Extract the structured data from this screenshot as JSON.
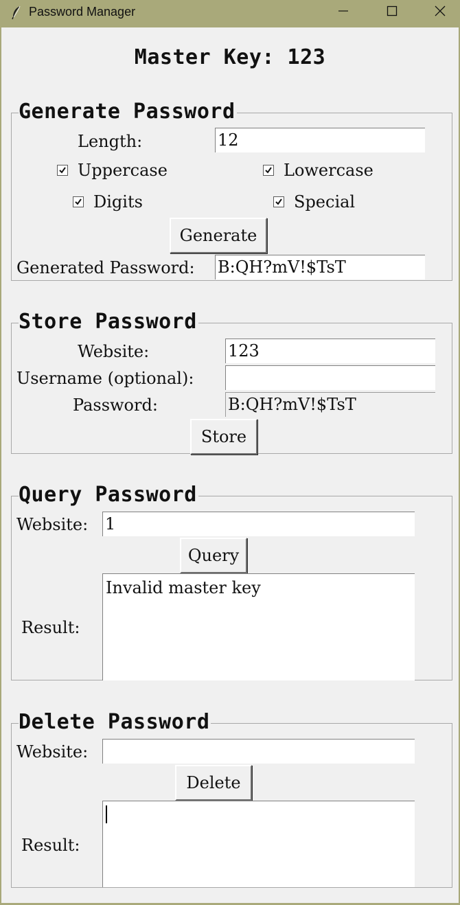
{
  "window": {
    "title": "Password Manager"
  },
  "master_key": "Master Key: 123",
  "generate": {
    "legend": "Generate Password",
    "length_label": "Length:",
    "length_value": "12",
    "uppercase_label": "Uppercase",
    "uppercase_checked": true,
    "lowercase_label": "Lowercase",
    "lowercase_checked": true,
    "digits_label": "Digits",
    "digits_checked": true,
    "special_label": "Special",
    "special_checked": true,
    "button": "Generate",
    "result_label": "Generated Password:",
    "result_value": "B:QH?mV!$TsT"
  },
  "store": {
    "legend": "Store Password",
    "website_label": "Website:",
    "website_value": "123",
    "username_label": "Username (optional):",
    "username_value": "",
    "password_label": "Password:",
    "password_value": "B:QH?mV!$TsT",
    "button": "Store"
  },
  "query": {
    "legend": "Query Password",
    "website_label": "Website:",
    "website_value": "1",
    "button": "Query",
    "result_label": "Result:",
    "result_text": "Invalid master key"
  },
  "delete": {
    "legend": "Delete Password",
    "website_label": "Website:",
    "website_value": "",
    "button": "Delete",
    "result_label": "Result:",
    "result_text": ""
  },
  "icons": {
    "app": "feather-icon",
    "minimize": "minimize-icon",
    "maximize": "maximize-icon",
    "close": "close-icon",
    "check": "checkmark-icon"
  },
  "colors": {
    "titlebar": "#a9a97a",
    "background": "#f0f0f0",
    "frame_border": "#a8a8a8"
  }
}
